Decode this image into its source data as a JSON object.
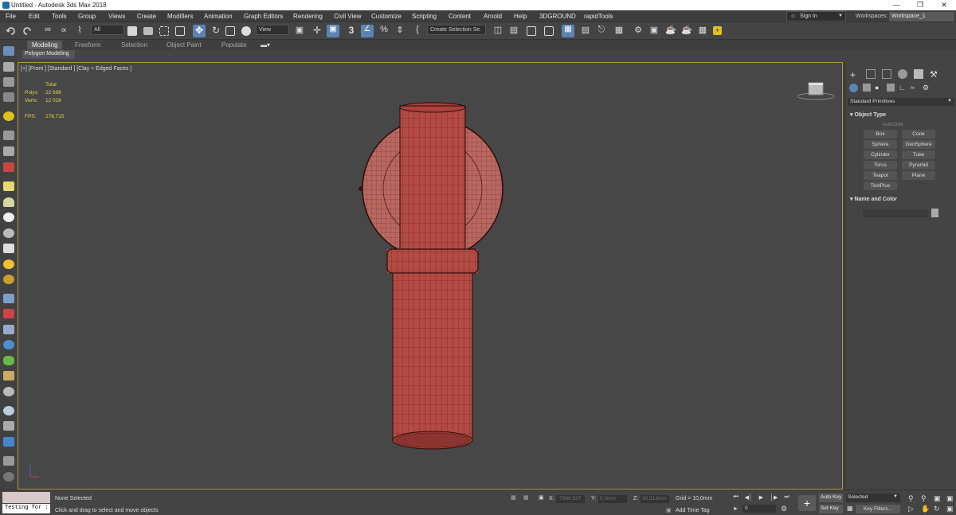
{
  "window": {
    "title": "Untitled - Autodesk 3ds Max 2018"
  },
  "menu": {
    "items": [
      "File",
      "Edit",
      "Tools",
      "Group",
      "Views",
      "Create",
      "Modifiers",
      "Animation",
      "Graph Editors",
      "Rendering",
      "Civil View",
      "Customize",
      "Scripting",
      "Content",
      "Arnold",
      "Help",
      "3DGROUND",
      "rapidTools"
    ]
  },
  "account": {
    "sign_in": "Sign In",
    "workspaces_label": "Workspaces:",
    "workspace": "Workspace_1"
  },
  "toolbar": {
    "selection_filter": "All",
    "ref_coord": "View",
    "selection_set": "Create Selection Se"
  },
  "ribbon": {
    "tabs": [
      "Modeling",
      "Freeform",
      "Selection",
      "Object Paint",
      "Populate"
    ],
    "active_tab": "Modeling",
    "sub": "Polygon Modeling"
  },
  "viewport": {
    "label": "[+] [Front ] [Standard ] [Clay + Edged Faces ]",
    "stats": {
      "total": "Total",
      "polys_label": "Polys:",
      "polys": "22 698",
      "verts_label": "Verts:",
      "verts": "12 028",
      "fps_label": "FPS:",
      "fps": "278,715"
    },
    "colors": {
      "mesh": "#b34a44",
      "wire": "#5a1a16",
      "frame": "#b09a3f",
      "background": "#474747"
    }
  },
  "command_panel": {
    "category": "Standard Primitives",
    "object_type_title": "Object Type",
    "autogrid": "AutoGrid",
    "buttons": [
      "Box",
      "Cone",
      "Sphere",
      "GeoSphere",
      "Cylinder",
      "Tube",
      "Torus",
      "Pyramid",
      "Teapot",
      "Plane",
      "TextPlus"
    ],
    "name_color_title": "Name and Color"
  },
  "status": {
    "maxscript_input": "Testing for :",
    "selection_info": "None Selected",
    "prompt": "Click and drag to select and move objects",
    "x_label": "X:",
    "x_value": "-7986,537",
    "y_label": "Y:",
    "y_value": "0,0mm",
    "z_label": "Z:",
    "z_value": "30,513mm",
    "grid": "Grid = 10,0mm",
    "add_time_tag": "Add Time Tag",
    "auto_key": "Auto Key",
    "set_key": "Set Key",
    "selected": "Selected",
    "key_filters": "Key Filters...",
    "frame": "0"
  }
}
